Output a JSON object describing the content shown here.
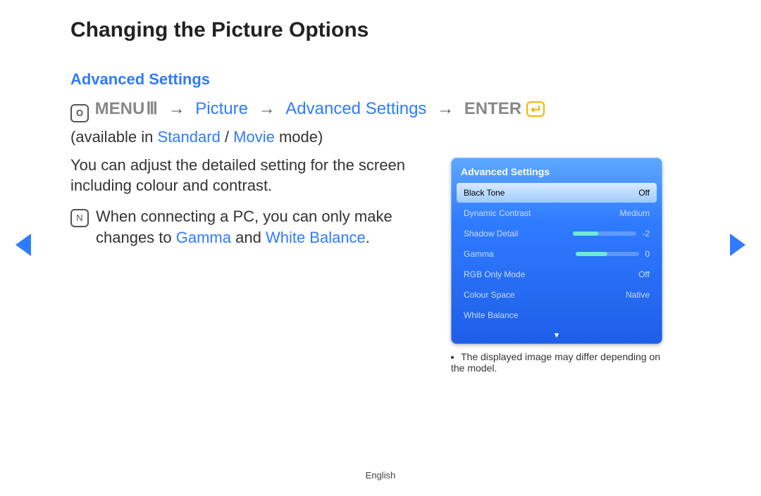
{
  "title": "Changing the Picture Options",
  "subhead": "Advanced Settings",
  "o_icon_text": "O",
  "nav": {
    "menu": "MENU",
    "picture": "Picture",
    "adv": "Advanced Settings",
    "enter": "ENTER",
    "arrow": "→"
  },
  "available_prefix": "available in ",
  "available_standard": "Standard",
  "available_sep": " / ",
  "available_movie": "Movie",
  "available_suffix": " mode)",
  "body_para": "You can adjust the detailed setting for the screen including colour and contrast.",
  "note_icon_text": "N",
  "note_prefix": "When connecting a PC, you can only make changes to ",
  "note_gamma": "Gamma",
  "note_and": " and ",
  "note_wb": "White Balance",
  "note_end": ".",
  "panel": {
    "title": "Advanced Settings",
    "rows": [
      {
        "label": "Black Tone",
        "value": "Off",
        "selected": true
      },
      {
        "label": "Dynamic Contrast",
        "value": "Medium"
      },
      {
        "label": "Shadow Detail",
        "value": "-2",
        "slider": 40
      },
      {
        "label": "Gamma",
        "value": "0",
        "slider": 50
      },
      {
        "label": "RGB Only Mode",
        "value": "Off"
      },
      {
        "label": "Colour Space",
        "value": "Native"
      },
      {
        "label": "White Balance",
        "value": ""
      }
    ],
    "scroll": "▼"
  },
  "caption": "The displayed image may differ depending on the model.",
  "footer": "English"
}
